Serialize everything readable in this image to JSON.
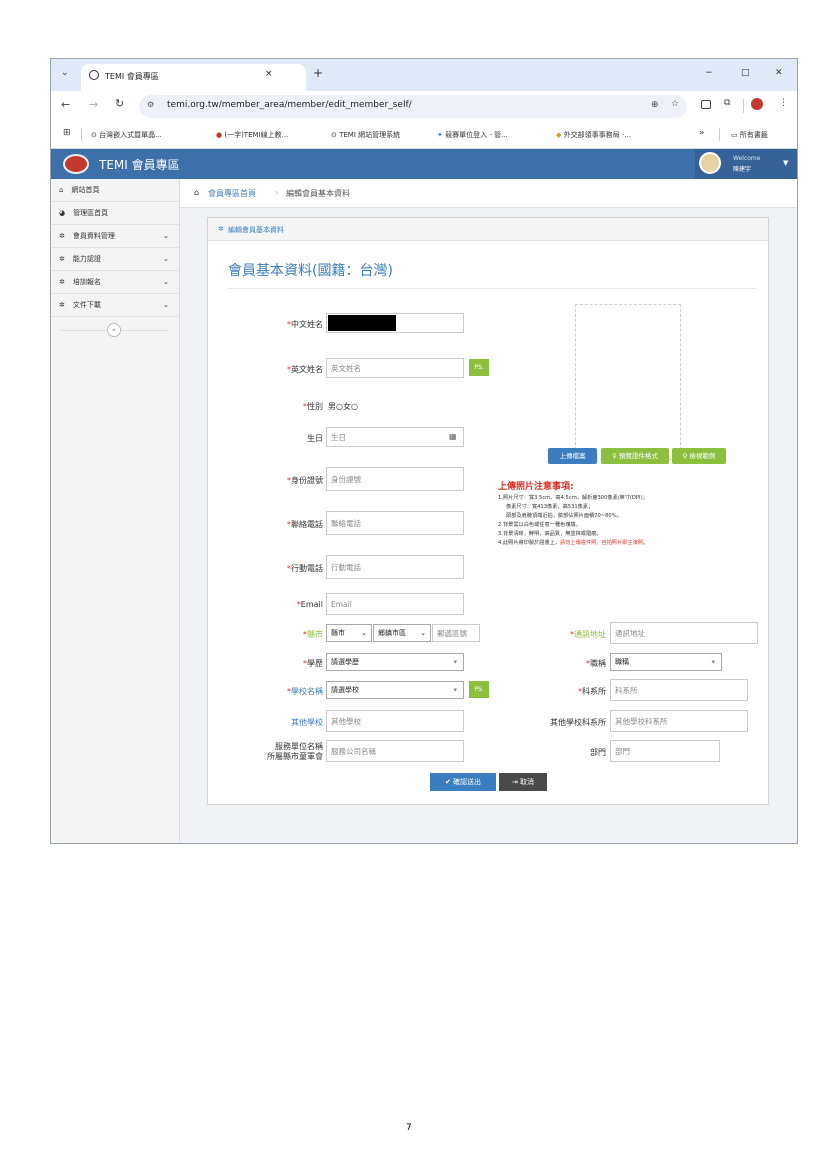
{
  "browser": {
    "tab_title": "TEMI 會員專區",
    "tab_close": "×",
    "new_tab": "+",
    "win_min": "−",
    "win_max": "□",
    "win_close": "✕",
    "url": "temi.org.tw/member_area/member/edit_member_self/",
    "bookmarks": [
      "台灣嵌入式暨單晶...",
      "(一字)TEMI線上教...",
      "TEMI 網站管理系統",
      "競賽單位登入 - 管...",
      "外交部領事事務局 -..."
    ],
    "more_bookmarks": "»",
    "all_bookmarks": "所有書籤"
  },
  "app": {
    "title": "TEMI 會員專區",
    "welcome": "Welcome",
    "user_name": "陳建宇"
  },
  "sidebar": {
    "items": [
      {
        "label": "網站首頁"
      },
      {
        "label": "管理區首頁"
      },
      {
        "label": "會員資料管理"
      },
      {
        "label": "能力認證"
      },
      {
        "label": "培訓報名"
      },
      {
        "label": "文件下載"
      }
    ],
    "collapse": "«"
  },
  "breadcrumb": {
    "home": "會員專區首頁",
    "sep": "›",
    "current": "編輯會員基本資料"
  },
  "panel": {
    "heading": "編輯會員基本資料",
    "title": "會員基本資料(國籍：台灣)"
  },
  "form": {
    "chinese_name_label": "中文姓名",
    "english_name_label": "英文姓名",
    "english_name_placeholder": "英文姓名",
    "ps_label": "PS.",
    "gender_label": "性別",
    "gender_options": "男○女○",
    "birthday_label": "生日",
    "birthday_placeholder": "生日",
    "id_label": "身份證號",
    "id_placeholder": "身份證號",
    "phone_label": "聯絡電話",
    "phone_placeholder": "聯絡電話",
    "mobile_label": "行動電話",
    "mobile_placeholder": "行動電話",
    "email_label": "Email",
    "email_placeholder": "Email",
    "county_label": "縣市",
    "county_select": "縣市",
    "district_select": "鄉鎮市區",
    "zip_placeholder": "郵遞區號",
    "address_label": "通訊地址",
    "address_placeholder": "通訊地址",
    "education_label": "學歷",
    "education_select": "請選學歷",
    "title_label": "職稱",
    "title_select": "職稱",
    "school_label": "學校名稱",
    "school_select": "請選學校",
    "department_label": "科系所",
    "department_placeholder": "科系所",
    "other_school_label": "其他學校",
    "other_school_placeholder": "其他學校",
    "other_dept_label": "其他學校科系所",
    "other_dept_placeholder": "其他學校科系所",
    "company_label_1": "服務單位名稱",
    "company_label_2": "所屬縣市童軍會",
    "company_placeholder": "服務公司名稱",
    "unit_label": "部門",
    "unit_placeholder": "部門",
    "submit_label": "確認送出",
    "cancel_label": "取消"
  },
  "photo": {
    "upload_label": "上傳檔案",
    "preview_label": "預覽證件格式",
    "example_label": "檢視範例",
    "notes_title": "上傳照片注意事項:",
    "notes": [
      "1.照片尺寸：寬3.5cm、高4.5cm，解析度300像素/英寸(DPI)；",
      "像素尺寸：寬413像素、高531像素；",
      "頭部及肩膀頂端近拍，臉部佔照片面積70~80%。",
      "2.背景需以白色或任意一種色塊填。",
      "3.背景清晰，鮮明，高品質，無塗抹或摺痕。",
      "4.此照片將印製於證書上，"
    ],
    "notes_red": "請勿上傳證件照，自拍照片即主演照",
    "notes_end": "。"
  },
  "page_number": "7"
}
